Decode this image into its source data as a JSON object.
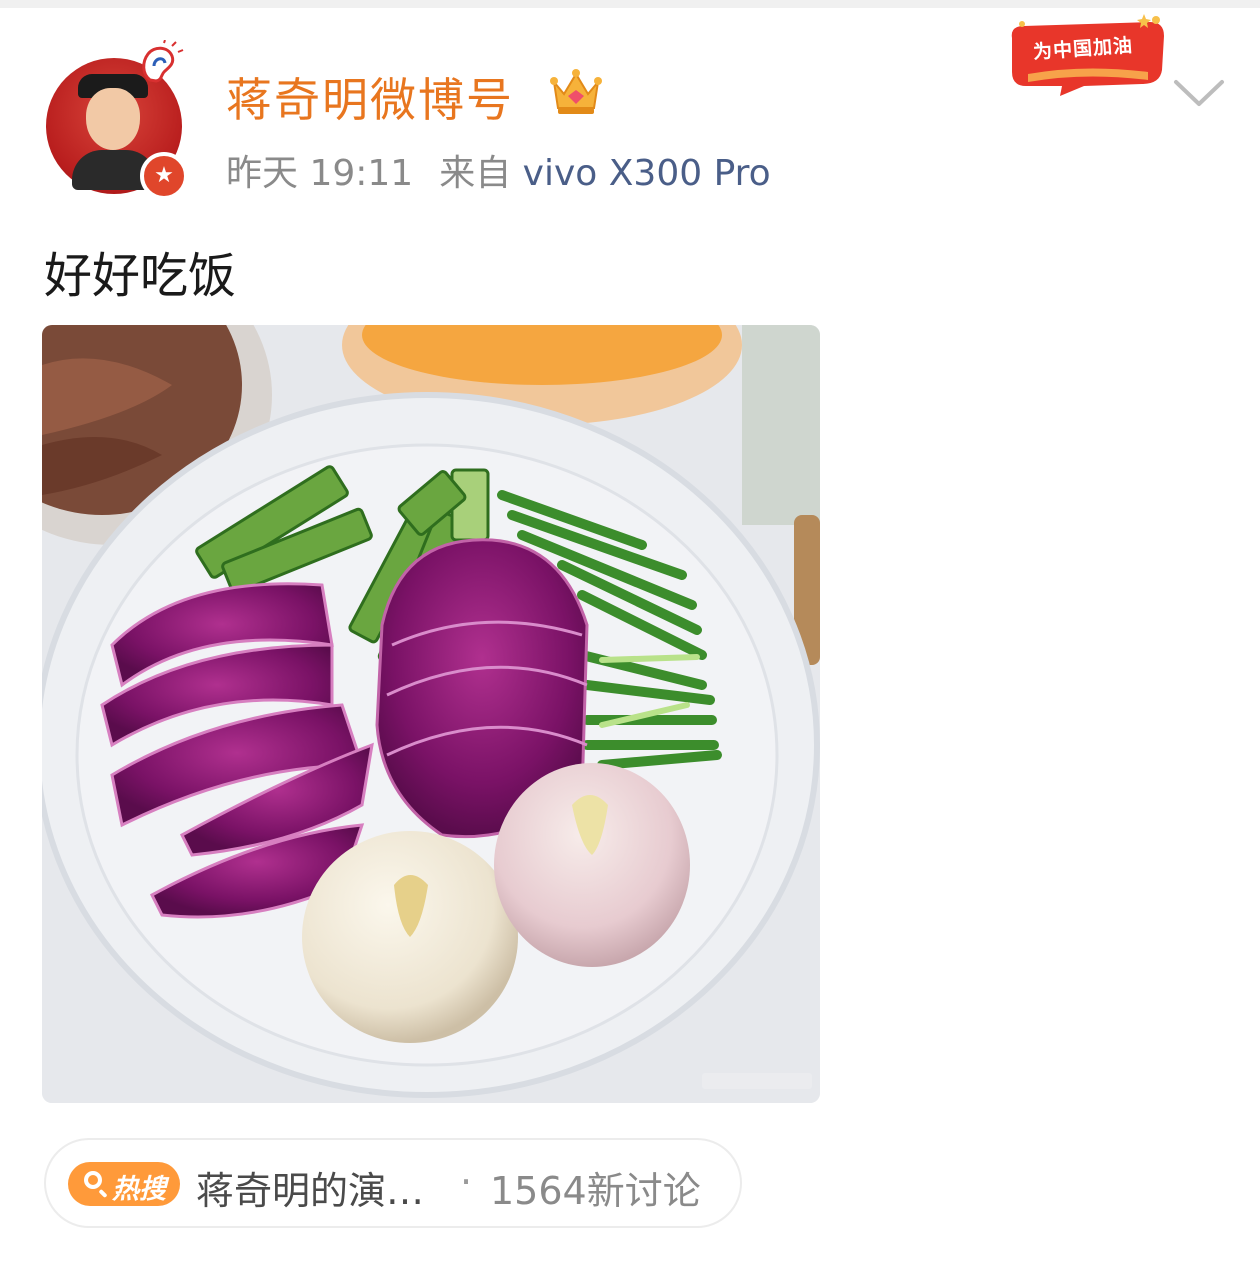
{
  "post": {
    "author": "蒋奇明微博号",
    "time": "昨天 19:11",
    "source_prefix": "来自",
    "device": "vivo X300 Pro",
    "text": "好好吃饭",
    "promo_badge": "为中国加油"
  },
  "hot_search": {
    "badge": "热搜",
    "title": "蒋奇明的演…",
    "separator": "·",
    "count": "1564新讨论"
  },
  "colors": {
    "username": "#e8761f",
    "device": "#4a5e88",
    "hot_badge": "#ff9a3a"
  },
  "icons": {
    "crown": "crown-icon",
    "verified": "verified-star-icon",
    "menu": "chevron-down-icon",
    "search": "search-icon"
  }
}
